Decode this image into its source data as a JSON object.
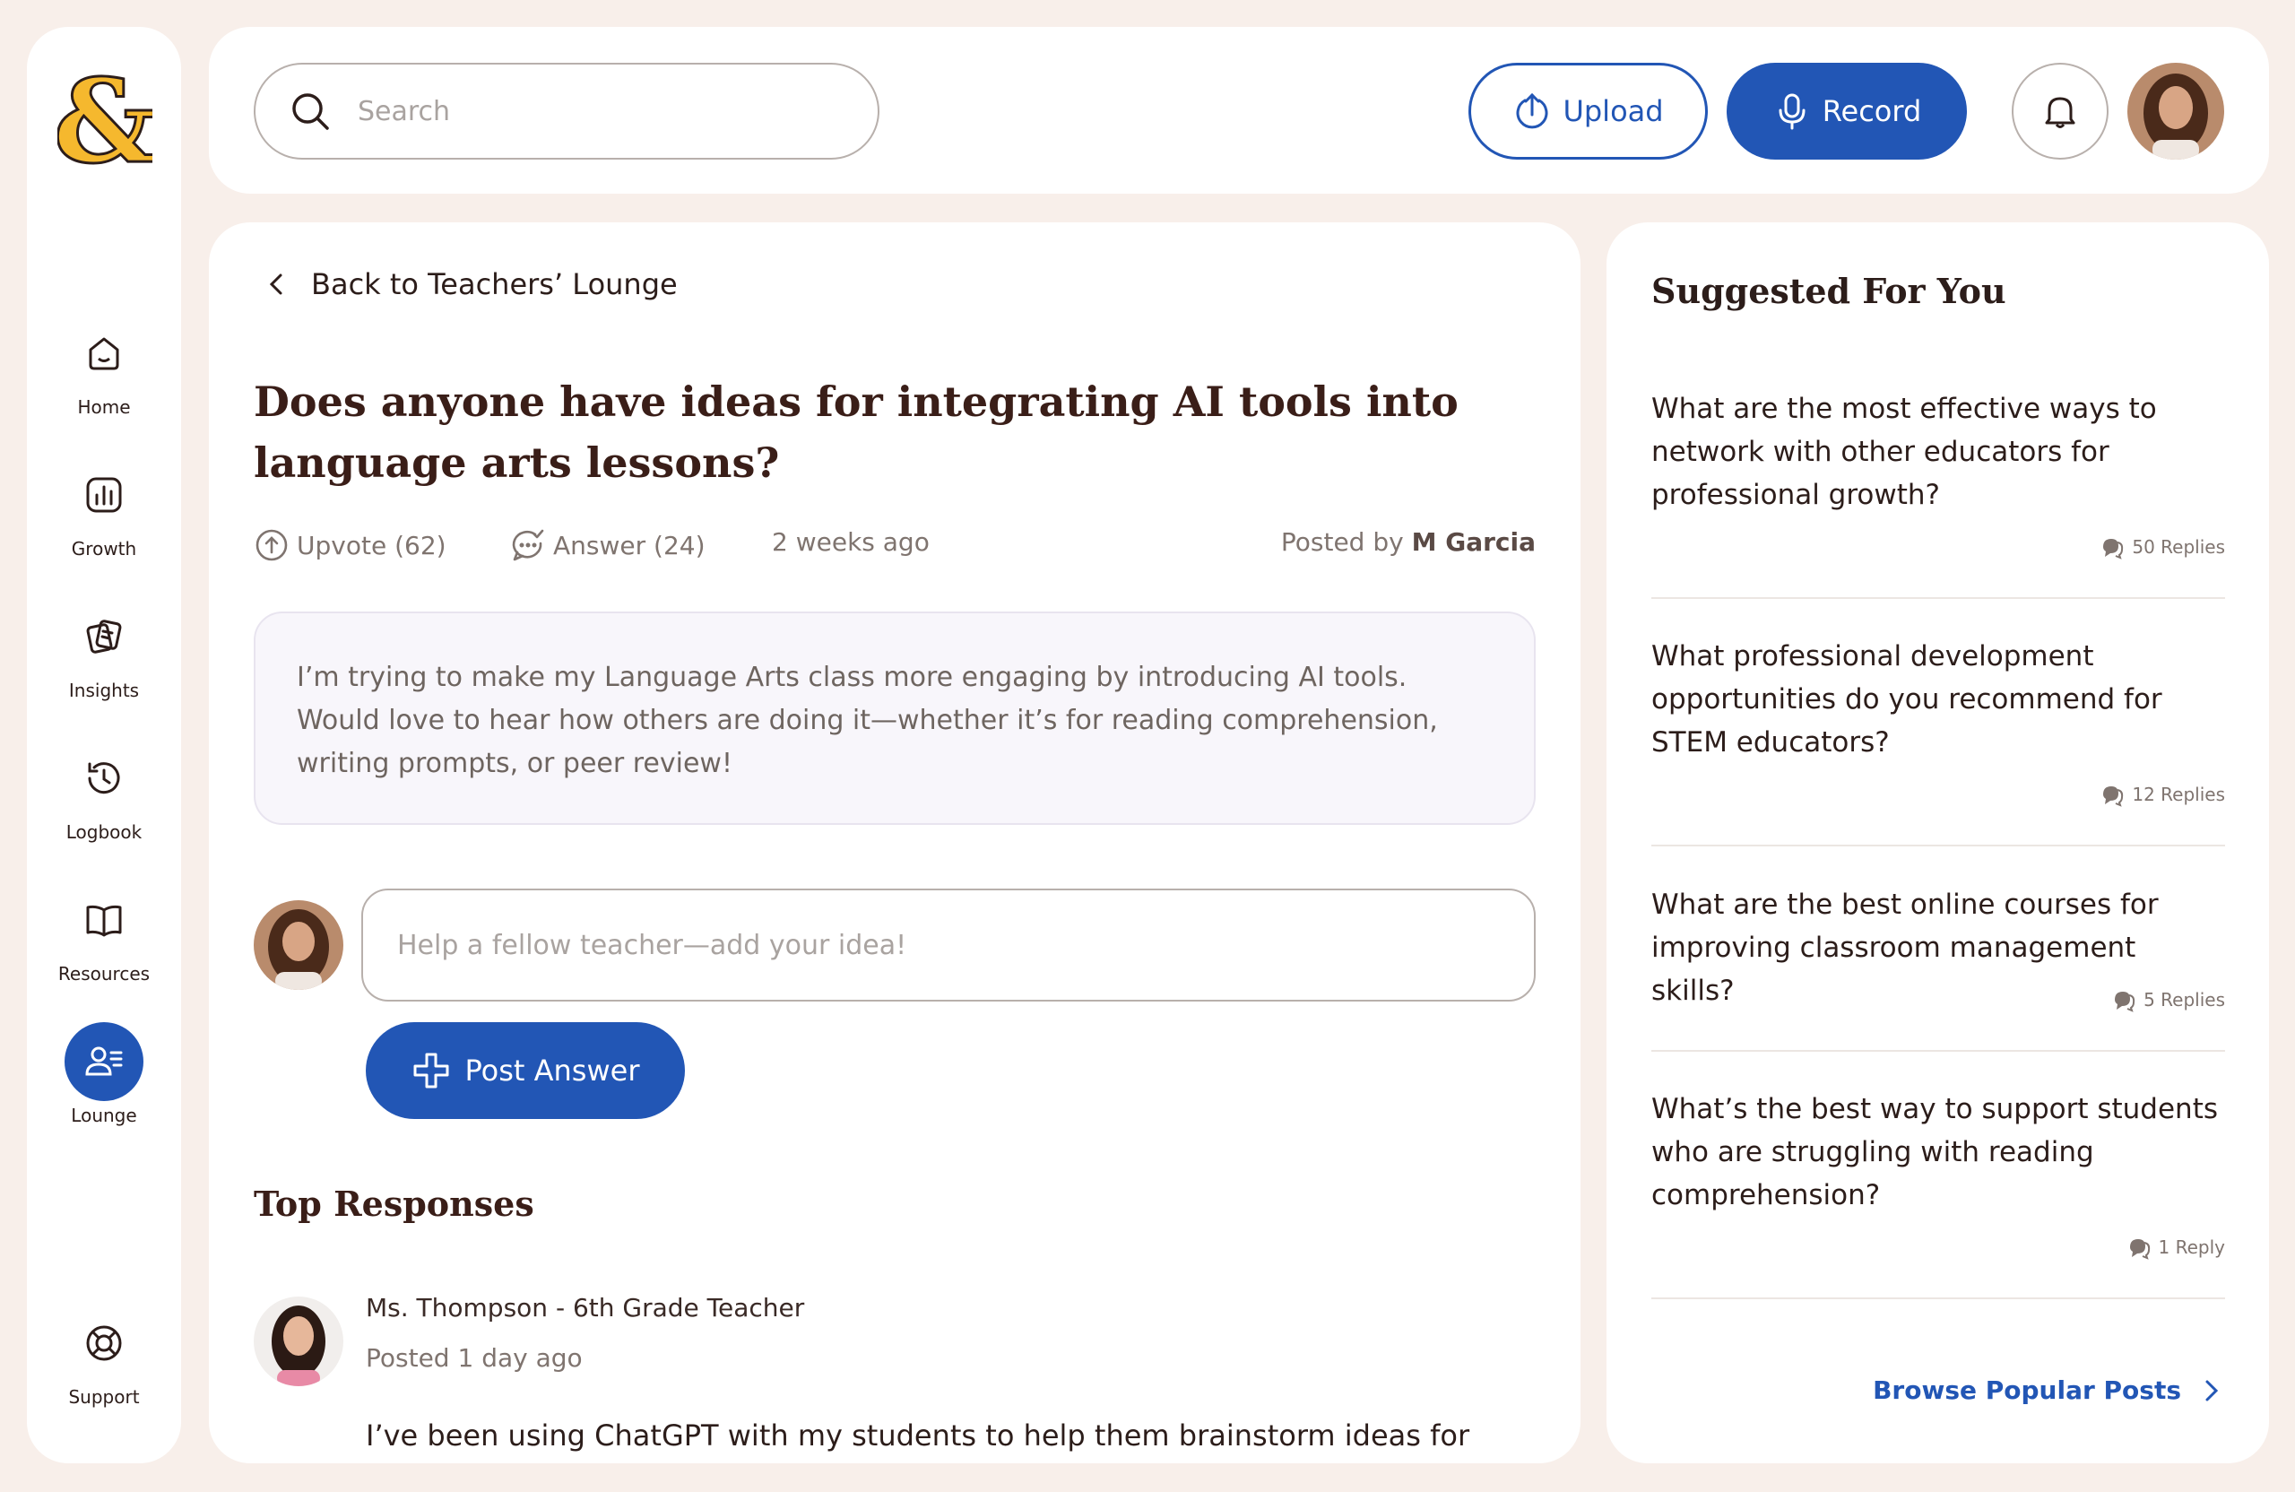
{
  "sidebar": {
    "logo": "&",
    "items": [
      {
        "label": "Home",
        "icon": "home-icon"
      },
      {
        "label": "Growth",
        "icon": "chart-icon"
      },
      {
        "label": "Insights",
        "icon": "cards-icon"
      },
      {
        "label": "Logbook",
        "icon": "history-icon"
      },
      {
        "label": "Resources",
        "icon": "book-icon"
      },
      {
        "label": "Lounge",
        "icon": "people-icon",
        "active": true
      }
    ],
    "support": {
      "label": "Support",
      "icon": "lifebuoy-icon"
    }
  },
  "topbar": {
    "search_placeholder": "Search",
    "upload_label": "Upload",
    "record_label": "Record"
  },
  "main": {
    "back_label": "Back to Teachers’ Lounge",
    "title": "Does anyone have ideas for integrating AI tools into language arts lessons?",
    "upvote_label": "Upvote (62)",
    "answer_label": "Answer (24)",
    "posted_time": "2 weeks ago",
    "posted_by_prefix": "Posted by",
    "posted_by_name": "M Garcia",
    "question_body": "I’m trying to make my Language Arts class more engaging by introducing AI tools. Would love to hear how others are doing it—whether it’s for reading comprehension, writing prompts, or peer review!",
    "answer_placeholder": "Help a fellow teacher—add your idea!",
    "post_button": "Post Answer",
    "top_responses_title": "Top Responses",
    "response": {
      "author": "Ms. Thompson - 6th Grade Teacher",
      "time": "Posted 1 day ago",
      "body": "I’ve been using ChatGPT with my students to help them brainstorm ideas for"
    }
  },
  "suggested": {
    "title": "Suggested For You",
    "items": [
      {
        "question": "What are the most effective ways to network with other educators for professional growth?",
        "replies": "50 Replies"
      },
      {
        "question": "What professional development opportunities do you recommend for STEM educators?",
        "replies": "12 Replies"
      },
      {
        "question": "What are the best online courses for improving classroom management skills?",
        "replies": "5 Replies"
      },
      {
        "question": "What’s the best way to support students who are struggling with reading comprehension?",
        "replies": "1 Reply"
      }
    ],
    "browse_label": "Browse Popular Posts"
  },
  "colors": {
    "accent": "#2256b5",
    "background": "#f8efea",
    "logo": "#f5b82e"
  }
}
